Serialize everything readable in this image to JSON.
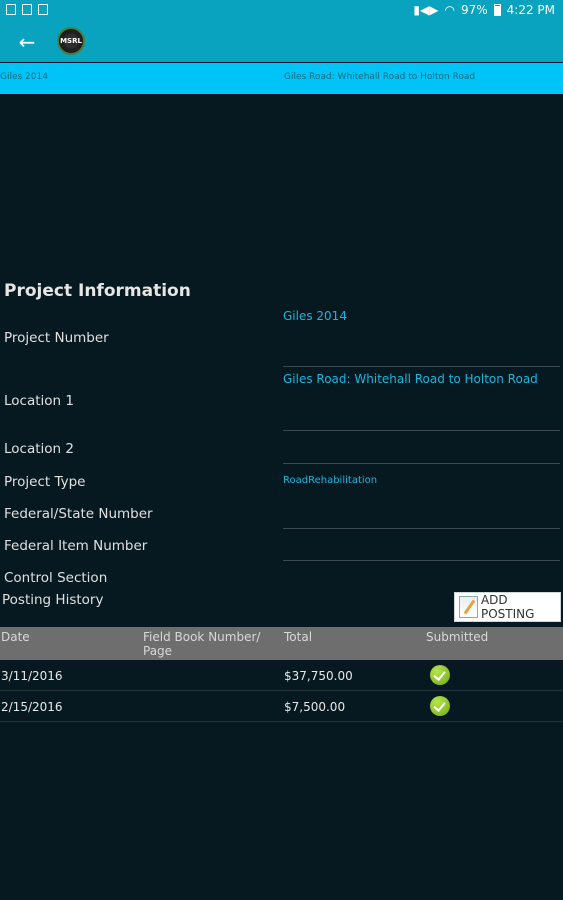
{
  "status_bar": {
    "battery": "97%",
    "time": "4:22 PM"
  },
  "app_bar": {
    "logo_text": "MSRL"
  },
  "sub_header": {
    "project_name": "Giles 2014",
    "location": "Giles Road: Whitehall Road to Holton Road"
  },
  "project_info": {
    "title": "Project Information",
    "fields": [
      {
        "label": "Project Number",
        "value": "Giles 2014"
      },
      {
        "label": "Location 1",
        "value": "Giles Road: Whitehall Road to Holton Road"
      },
      {
        "label": "Location 2",
        "value": ""
      },
      {
        "label": "Project Type",
        "value": "RoadRehabilitation"
      },
      {
        "label": "Federal/State Number",
        "value": ""
      },
      {
        "label": "Federal Item Number",
        "value": ""
      },
      {
        "label": "Control Section",
        "value": ""
      }
    ]
  },
  "posting": {
    "title": "Posting History",
    "add_button": "ADD POSTING",
    "columns": [
      "Date",
      "Field Book Number/ Page",
      "Total",
      "Submitted"
    ],
    "rows": [
      {
        "date": "3/11/2016",
        "field_book": "",
        "total": "$37,750.00",
        "submitted": "check-icon"
      },
      {
        "date": "2/15/2016",
        "field_book": "",
        "total": "$7,500.00",
        "submitted": "check-icon"
      }
    ]
  },
  "colors": {
    "app_bar": "#0aa3bf",
    "sub_header": "#00c3f7",
    "background": "#061820",
    "value_text": "#18b6e0",
    "table_header": "#6e6e6e",
    "check": "#8cc63f"
  }
}
